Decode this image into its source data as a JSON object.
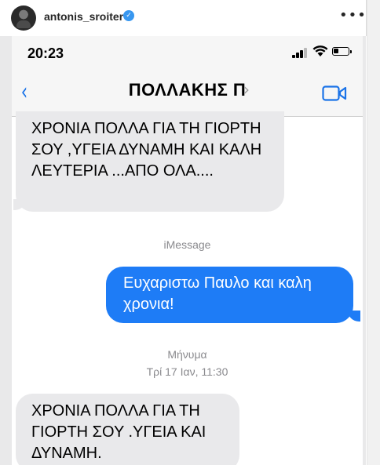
{
  "post": {
    "username": "antonis_sroiter",
    "verified_icon": "verified-badge-icon",
    "more_icon": "more-horizontal-icon"
  },
  "statusbar": {
    "time": "20:23",
    "signal_bars": 4,
    "signal_bars_active": 3,
    "battery_level": 0.35
  },
  "navbar": {
    "contact": "ΠΟΛΛΑΚΗΣ Π",
    "back_icon": "chevron-left-icon",
    "video_icon": "video-camera-icon"
  },
  "messages": [
    {
      "direction": "incoming",
      "text": "ΧΡΟΝΙΑ ΠΟΛΛΑ ΓΙΑ ΤΗ ΓΙΟΡΤΗ ΣΟΥ ,ΥΓΕΙΑ ΔΥΝΑΜΗ ΚΑΙ ΚΑΛΗ ΛΕΥΤΕΡΙΑ ...ΑΠΟ ΟΛΑ...."
    },
    {
      "direction": "outgoing",
      "text": "Ευχαριστω Παυλο και καλη χρονια!"
    },
    {
      "direction": "incoming",
      "text": "ΧΡΟΝΙΑ ΠΟΛΛΑ ΓΙΑ ΤΗ ΓΙΟΡΤΗ ΣΟΥ .ΥΓΕΙΑ ΚΑΙ ΔΥΝΑΜΗ."
    }
  ],
  "labels": {
    "service": "iMessage",
    "meta": "Μήνυμα",
    "timestamp": "Τρί 17 Ιαν, 11:30"
  },
  "colors": {
    "accent_blue": "#1a73e8",
    "outgoing_bubble": "#1e7cf6",
    "incoming_bubble": "#e9e9eb",
    "verified": "#3897f0"
  }
}
